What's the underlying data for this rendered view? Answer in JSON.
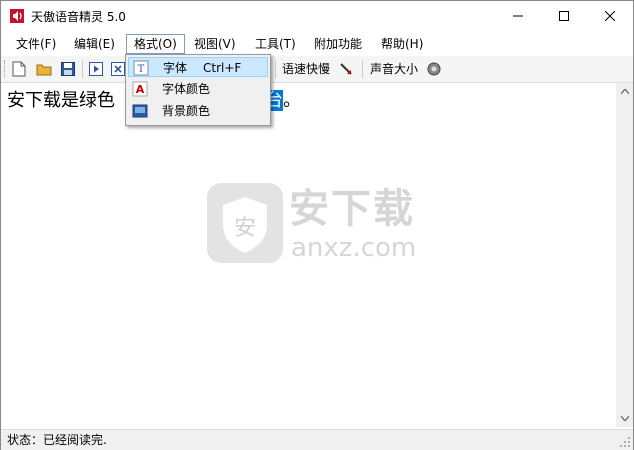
{
  "window": {
    "title": "天傲语音精灵 5.0"
  },
  "menus": [
    {
      "label": "文件(F)"
    },
    {
      "label": "编辑(E)"
    },
    {
      "label": "格式(O)"
    },
    {
      "label": "视图(V)"
    },
    {
      "label": "工具(T)"
    },
    {
      "label": "附加功能"
    },
    {
      "label": "帮助(H)"
    }
  ],
  "format_menu": {
    "items": [
      {
        "label": "字体",
        "shortcut": "Ctrl+F",
        "icon": "font-icon"
      },
      {
        "label": "字体颜色",
        "icon": "font-color-icon"
      },
      {
        "label": "背景颜色",
        "icon": "background-color-icon"
      }
    ]
  },
  "toolbar": {
    "speed_label": "语速快慢",
    "volume_label": "声音大小"
  },
  "editor": {
    "text_before": "安下载是绿色",
    "text_selected": "台",
    "text_after": "。"
  },
  "watermark": {
    "cn": "安下载",
    "en": "anxz.com"
  },
  "status": {
    "text": "状态：已经阅读完."
  },
  "colors": {
    "selection": "#0078d7",
    "menu_highlight": "#cce8ff"
  }
}
